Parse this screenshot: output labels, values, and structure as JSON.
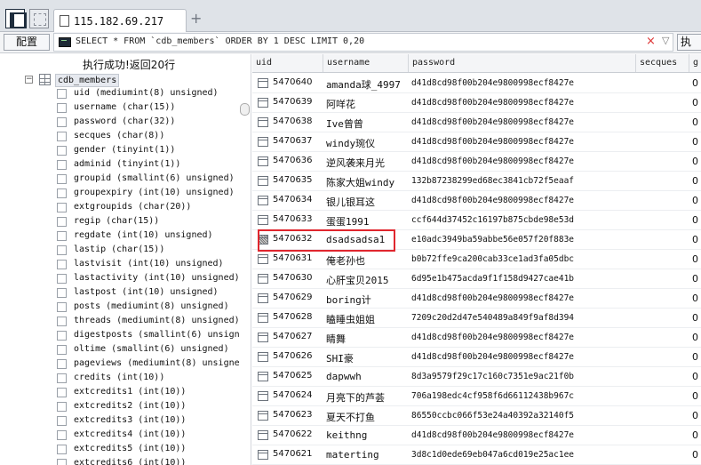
{
  "tab": {
    "title": "115.182.69.217"
  },
  "toolbar": {
    "config_label": "配置",
    "sql": "SELECT * FROM `cdb_members` ORDER BY 1 DESC LIMIT 0,20",
    "clear_glyph": "×",
    "dropdown_glyph": "▽",
    "execute_label": "执"
  },
  "left": {
    "status": "执行成功!返回20行",
    "table": "cdb_members",
    "fields": [
      "uid (mediumint(8) unsigned)",
      "username (char(15))",
      "password (char(32))",
      "secques (char(8))",
      "gender (tinyint(1))",
      "adminid (tinyint(1))",
      "groupid (smallint(6) unsigned)",
      "groupexpiry (int(10) unsigned)",
      "extgroupids (char(20))",
      "regip (char(15))",
      "regdate (int(10) unsigned)",
      "lastip (char(15))",
      "lastvisit (int(10) unsigned)",
      "lastactivity (int(10) unsigned)",
      "lastpost (int(10) unsigned)",
      "posts (mediumint(8) unsigned)",
      "threads (mediumint(8) unsigned)",
      "digestposts (smallint(6) unsign",
      "oltime (smallint(6) unsigned)",
      "pageviews (mediumint(8) unsigne",
      "credits (int(10))",
      "extcredits1 (int(10))",
      "extcredits2 (int(10))",
      "extcredits3 (int(10))",
      "extcredits4 (int(10))",
      "extcredits5 (int(10))",
      "extcredits6 (int(10))"
    ]
  },
  "grid": {
    "columns": [
      "uid",
      "username",
      "password",
      "secques",
      "g"
    ],
    "rows": [
      {
        "uid": "5470640",
        "username": "amanda球_4997",
        "password": "d41d8cd98f00b204e9800998ecf8427e",
        "secques": "0"
      },
      {
        "uid": "5470639",
        "username": "阿咩花",
        "password": "d41d8cd98f00b204e9800998ecf8427e",
        "secques": "0"
      },
      {
        "uid": "5470638",
        "username": "Ive曾曾",
        "password": "d41d8cd98f00b204e9800998ecf8427e",
        "secques": "0"
      },
      {
        "uid": "5470637",
        "username": "windy琬仪",
        "password": "d41d8cd98f00b204e9800998ecf8427e",
        "secques": "0"
      },
      {
        "uid": "5470636",
        "username": "逆风袭来月光",
        "password": "d41d8cd98f00b204e9800998ecf8427e",
        "secques": "0"
      },
      {
        "uid": "5470635",
        "username": "陈家大姐windy",
        "password": "132b87238299ed68ec3841cb72f5eaaf",
        "secques": "0"
      },
      {
        "uid": "5470634",
        "username": "银儿银耳这",
        "password": "d41d8cd98f00b204e9800998ecf8427e",
        "secques": "0"
      },
      {
        "uid": "5470633",
        "username": "蛋蛋1991",
        "password": "ccf644d37452c16197b875cbde98e53d",
        "secques": "0"
      },
      {
        "uid": "5470632",
        "username": "dsadsadsa1",
        "password": "e10adc3949ba59abbe56e057f20f883e",
        "secques": "0"
      },
      {
        "uid": "5470631",
        "username": "俺老孙也",
        "password": "b0b72ffe9ca200cab33ce1ad3fa05dbc",
        "secques": "0"
      },
      {
        "uid": "5470630",
        "username": "心肝宝贝2015",
        "password": "6d95e1b475acda9f1f158d9427cae41b",
        "secques": "0"
      },
      {
        "uid": "5470629",
        "username": "boring计",
        "password": "d41d8cd98f00b204e9800998ecf8427e",
        "secques": "0"
      },
      {
        "uid": "5470628",
        "username": "瞌睡虫姐姐",
        "password": "7209c20d2d47e540489a849f9af8d394",
        "secques": "0"
      },
      {
        "uid": "5470627",
        "username": "睛舞",
        "password": "d41d8cd98f00b204e9800998ecf8427e",
        "secques": "0"
      },
      {
        "uid": "5470626",
        "username": "SHI豪",
        "password": "d41d8cd98f00b204e9800998ecf8427e",
        "secques": "0"
      },
      {
        "uid": "5470625",
        "username": "dapwwh",
        "password": "8d3a9579f29c17c160c7351e9ac21f0b",
        "secques": "0"
      },
      {
        "uid": "5470624",
        "username": "月亮下的芦荟",
        "password": "706a198edc4cf958f6d66112438b967c",
        "secques": "0"
      },
      {
        "uid": "5470623",
        "username": "夏天不打鱼",
        "password": "86550ccbc066f53e24a40392a32140f5",
        "secques": "0"
      },
      {
        "uid": "5470622",
        "username": "keithng",
        "password": "d41d8cd98f00b204e9800998ecf8427e",
        "secques": "0"
      },
      {
        "uid": "5470621",
        "username": "materting",
        "password": "3d8c1d0ede69eb047a6cd019e25ac1ee",
        "secques": "0"
      }
    ]
  },
  "colors": {
    "highlight_border": "#e0262e",
    "header_bg": "#f4f5f7"
  }
}
